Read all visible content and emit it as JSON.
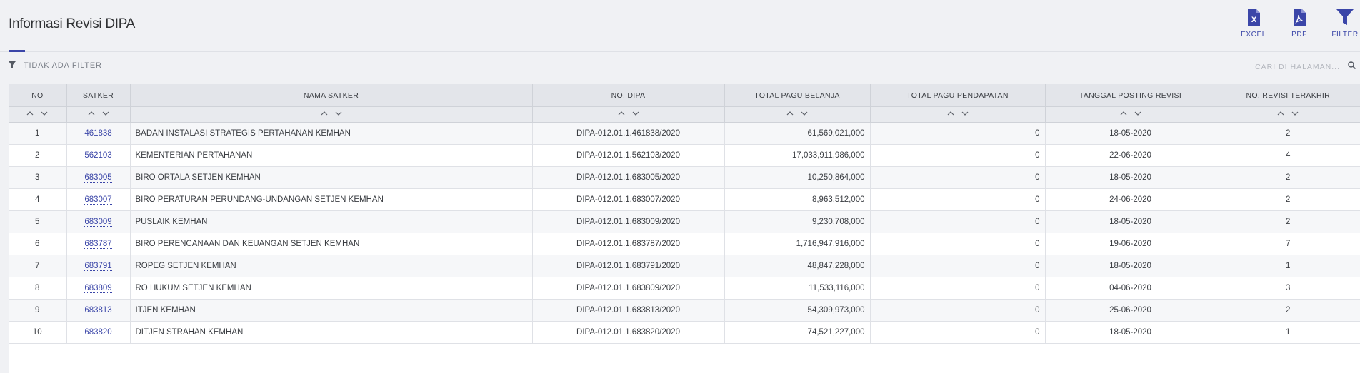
{
  "page": {
    "title": "Informasi Revisi DIPA"
  },
  "toolbar": {
    "excel_label": "EXCEL",
    "pdf_label": "PDF",
    "filter_label": "FILTER"
  },
  "filter": {
    "status_text": "TIDAK ADA FILTER"
  },
  "search": {
    "placeholder": "CARI DI HALAMAN..."
  },
  "colors": {
    "accent": "#3b46a8",
    "header_bg": "#e3e5ea",
    "page_bg": "#f0f1f4"
  },
  "table": {
    "columns": [
      "NO",
      "SATKER",
      "NAMA SATKER",
      "NO. DIPA",
      "TOTAL PAGU BELANJA",
      "TOTAL PAGU PENDAPATAN",
      "TANGGAL POSTING REVISI",
      "NO. REVISI TERAKHIR"
    ],
    "rows": [
      {
        "no": "1",
        "satker": "461838",
        "nama": "BADAN INSTALASI STRATEGIS PERTAHANAN KEMHAN",
        "dipa": "DIPA-012.01.1.461838/2020",
        "belanja": "61,569,021,000",
        "pendapatan": "0",
        "tanggal": "18-05-2020",
        "revisi": "2"
      },
      {
        "no": "2",
        "satker": "562103",
        "nama": "KEMENTERIAN PERTAHANAN",
        "dipa": "DIPA-012.01.1.562103/2020",
        "belanja": "17,033,911,986,000",
        "pendapatan": "0",
        "tanggal": "22-06-2020",
        "revisi": "4"
      },
      {
        "no": "3",
        "satker": "683005",
        "nama": "BIRO ORTALA SETJEN KEMHAN",
        "dipa": "DIPA-012.01.1.683005/2020",
        "belanja": "10,250,864,000",
        "pendapatan": "0",
        "tanggal": "18-05-2020",
        "revisi": "2"
      },
      {
        "no": "4",
        "satker": "683007",
        "nama": "BIRO PERATURAN PERUNDANG-UNDANGAN SETJEN KEMHAN",
        "dipa": "DIPA-012.01.1.683007/2020",
        "belanja": "8,963,512,000",
        "pendapatan": "0",
        "tanggal": "24-06-2020",
        "revisi": "2"
      },
      {
        "no": "5",
        "satker": "683009",
        "nama": "PUSLAIK KEMHAN",
        "dipa": "DIPA-012.01.1.683009/2020",
        "belanja": "9,230,708,000",
        "pendapatan": "0",
        "tanggal": "18-05-2020",
        "revisi": "2"
      },
      {
        "no": "6",
        "satker": "683787",
        "nama": "BIRO PERENCANAAN DAN KEUANGAN SETJEN KEMHAN",
        "dipa": "DIPA-012.01.1.683787/2020",
        "belanja": "1,716,947,916,000",
        "pendapatan": "0",
        "tanggal": "19-06-2020",
        "revisi": "7"
      },
      {
        "no": "7",
        "satker": "683791",
        "nama": "ROPEG SETJEN KEMHAN",
        "dipa": "DIPA-012.01.1.683791/2020",
        "belanja": "48,847,228,000",
        "pendapatan": "0",
        "tanggal": "18-05-2020",
        "revisi": "1"
      },
      {
        "no": "8",
        "satker": "683809",
        "nama": "RO HUKUM SETJEN KEMHAN",
        "dipa": "DIPA-012.01.1.683809/2020",
        "belanja": "11,533,116,000",
        "pendapatan": "0",
        "tanggal": "04-06-2020",
        "revisi": "3"
      },
      {
        "no": "9",
        "satker": "683813",
        "nama": "ITJEN KEMHAN",
        "dipa": "DIPA-012.01.1.683813/2020",
        "belanja": "54,309,973,000",
        "pendapatan": "0",
        "tanggal": "25-06-2020",
        "revisi": "2"
      },
      {
        "no": "10",
        "satker": "683820",
        "nama": "DITJEN STRAHAN KEMHAN",
        "dipa": "DIPA-012.01.1.683820/2020",
        "belanja": "74,521,227,000",
        "pendapatan": "0",
        "tanggal": "18-05-2020",
        "revisi": "1"
      }
    ]
  }
}
